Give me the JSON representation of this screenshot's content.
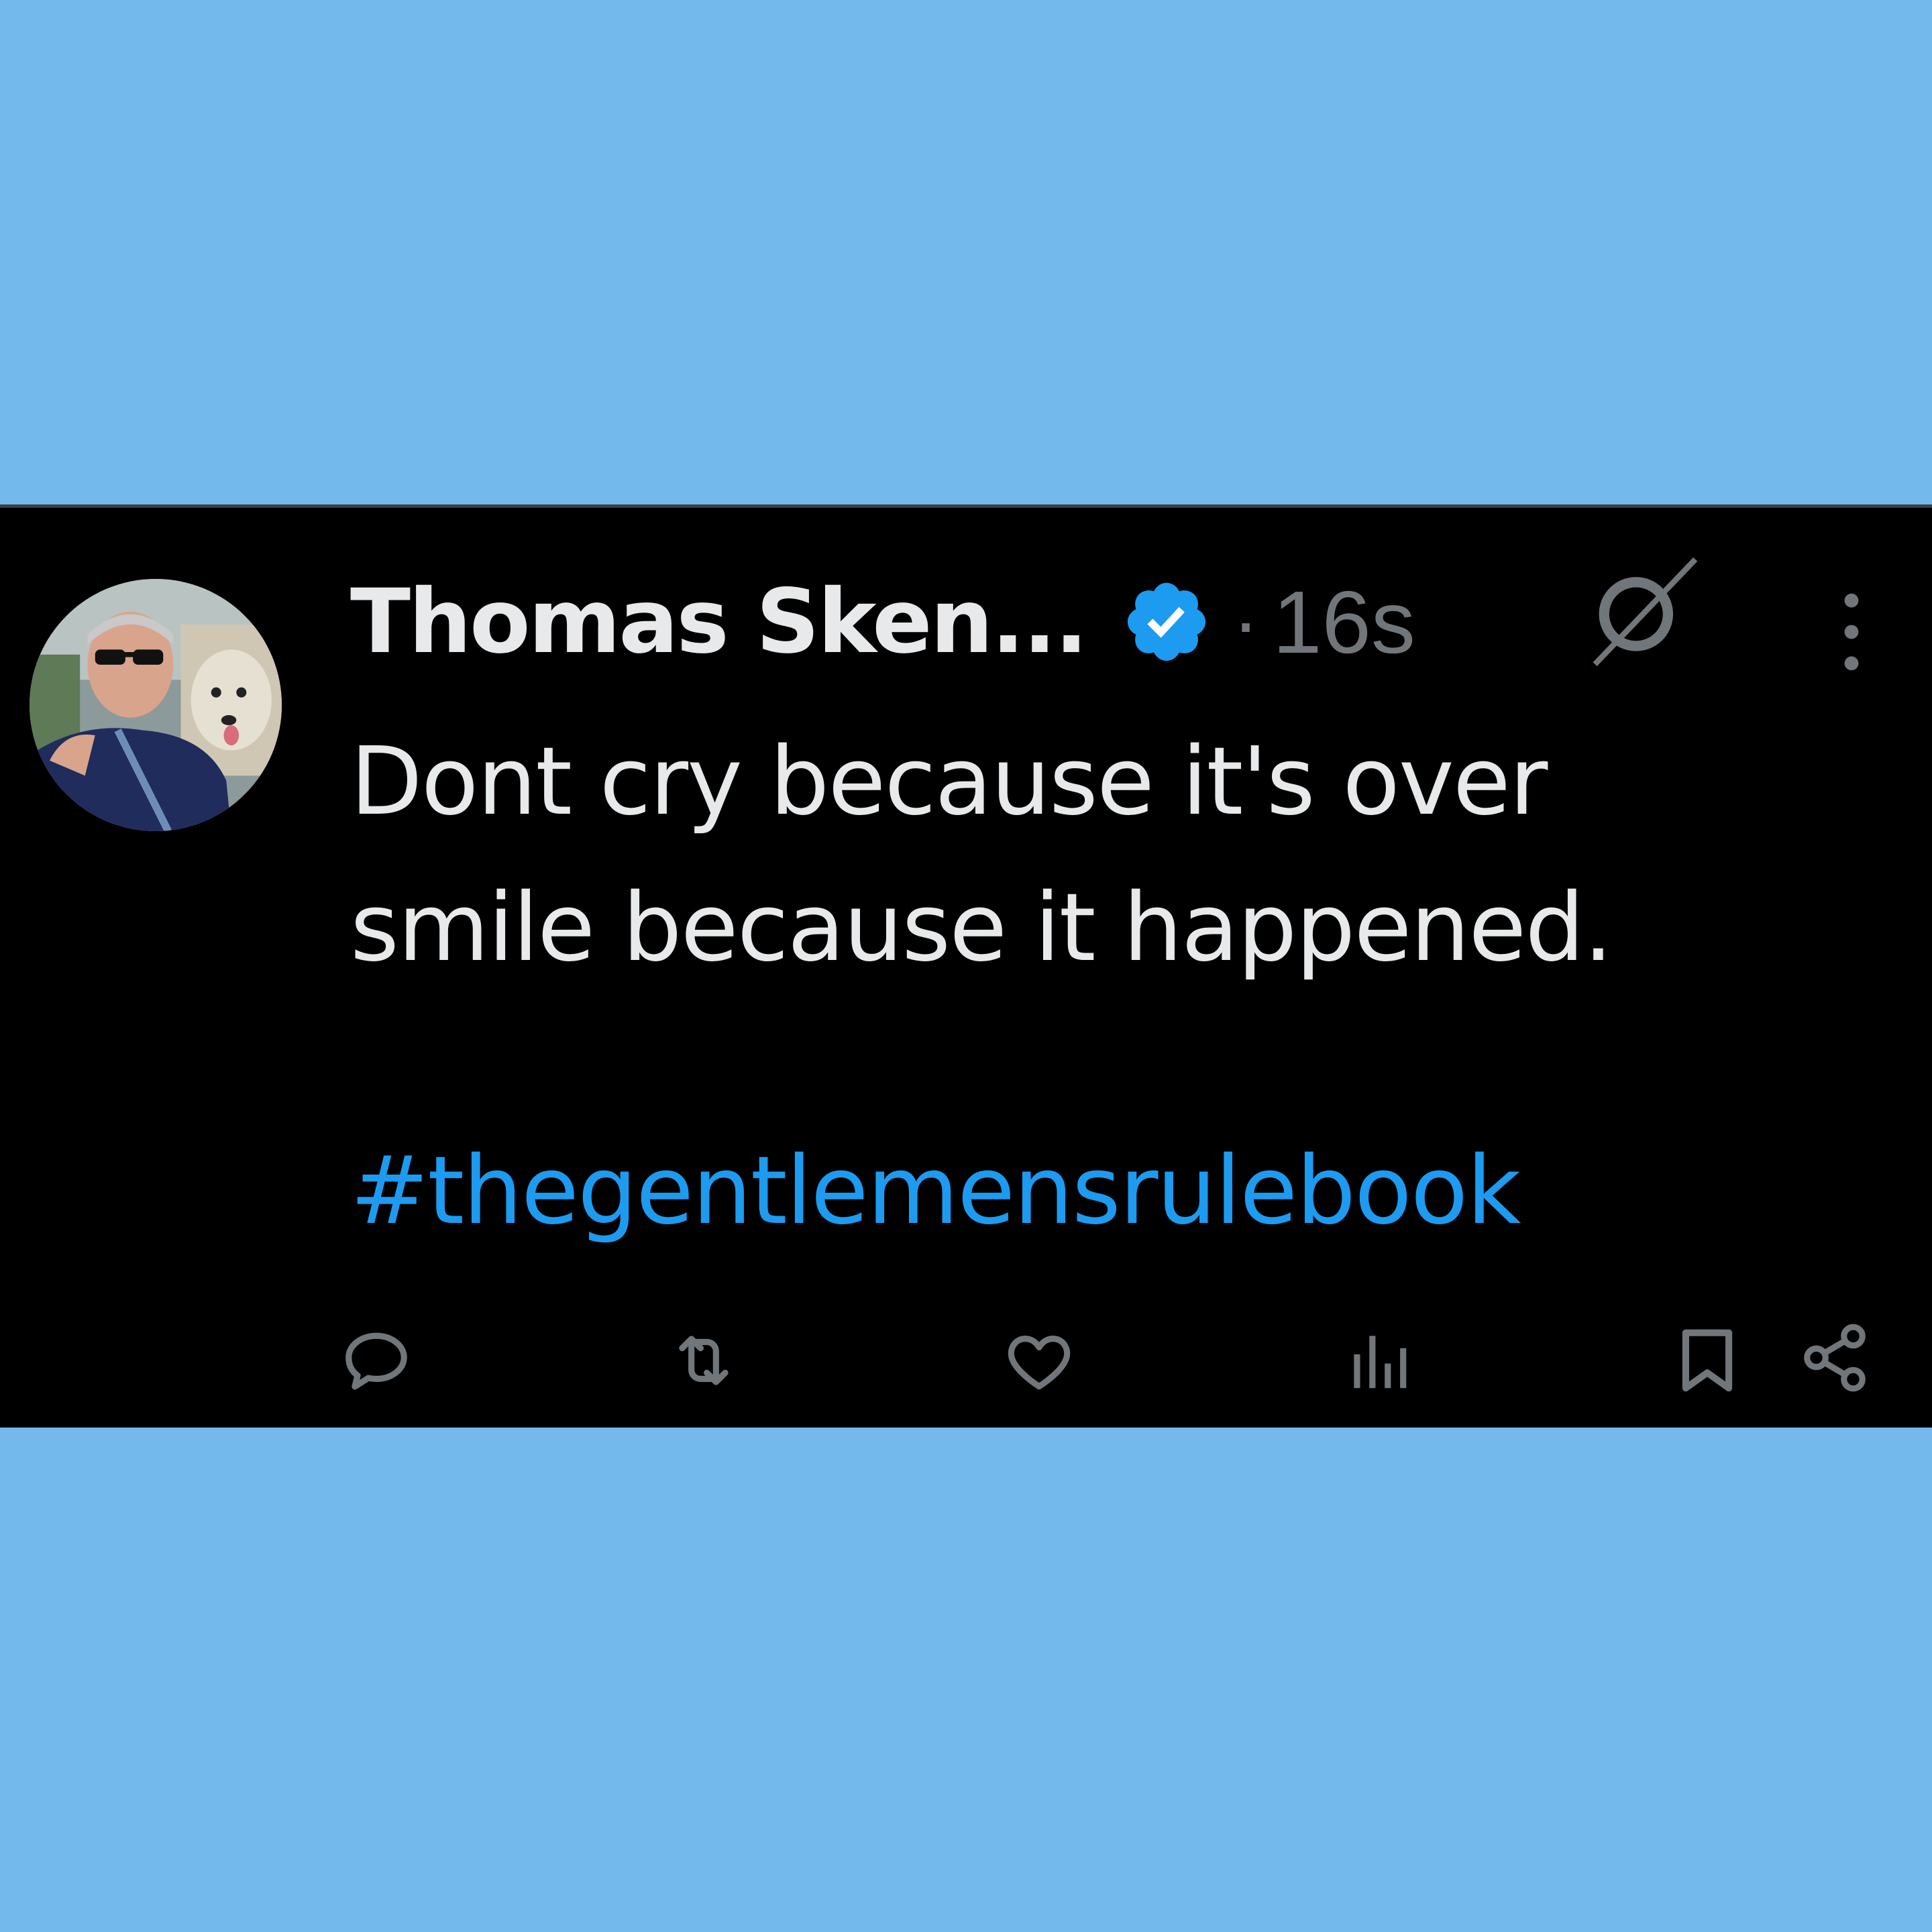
{
  "page": {
    "background_color": "#74b9ec",
    "card_background": "#000000"
  },
  "tweet": {
    "author": {
      "display_name": "Thomas Sken...",
      "verified": true,
      "verified_badge_color": "#1d9bf0",
      "avatar_icon": "avatar-photo"
    },
    "separator": "·",
    "timestamp": "16s",
    "text_lines": [
      "Dont cry because it's over",
      "smile because it happened."
    ],
    "hashtag": "#thegentlemensrulebook",
    "hashtag_color": "#1d9bf0",
    "text_color": "#e7e9ea",
    "muted_color": "#71767b",
    "header_icons": [
      "grok-icon",
      "more-options-icon"
    ],
    "action_icons": [
      "reply-icon",
      "retweet-icon",
      "like-icon",
      "views-icon",
      "bookmark-icon",
      "share-icon"
    ]
  }
}
